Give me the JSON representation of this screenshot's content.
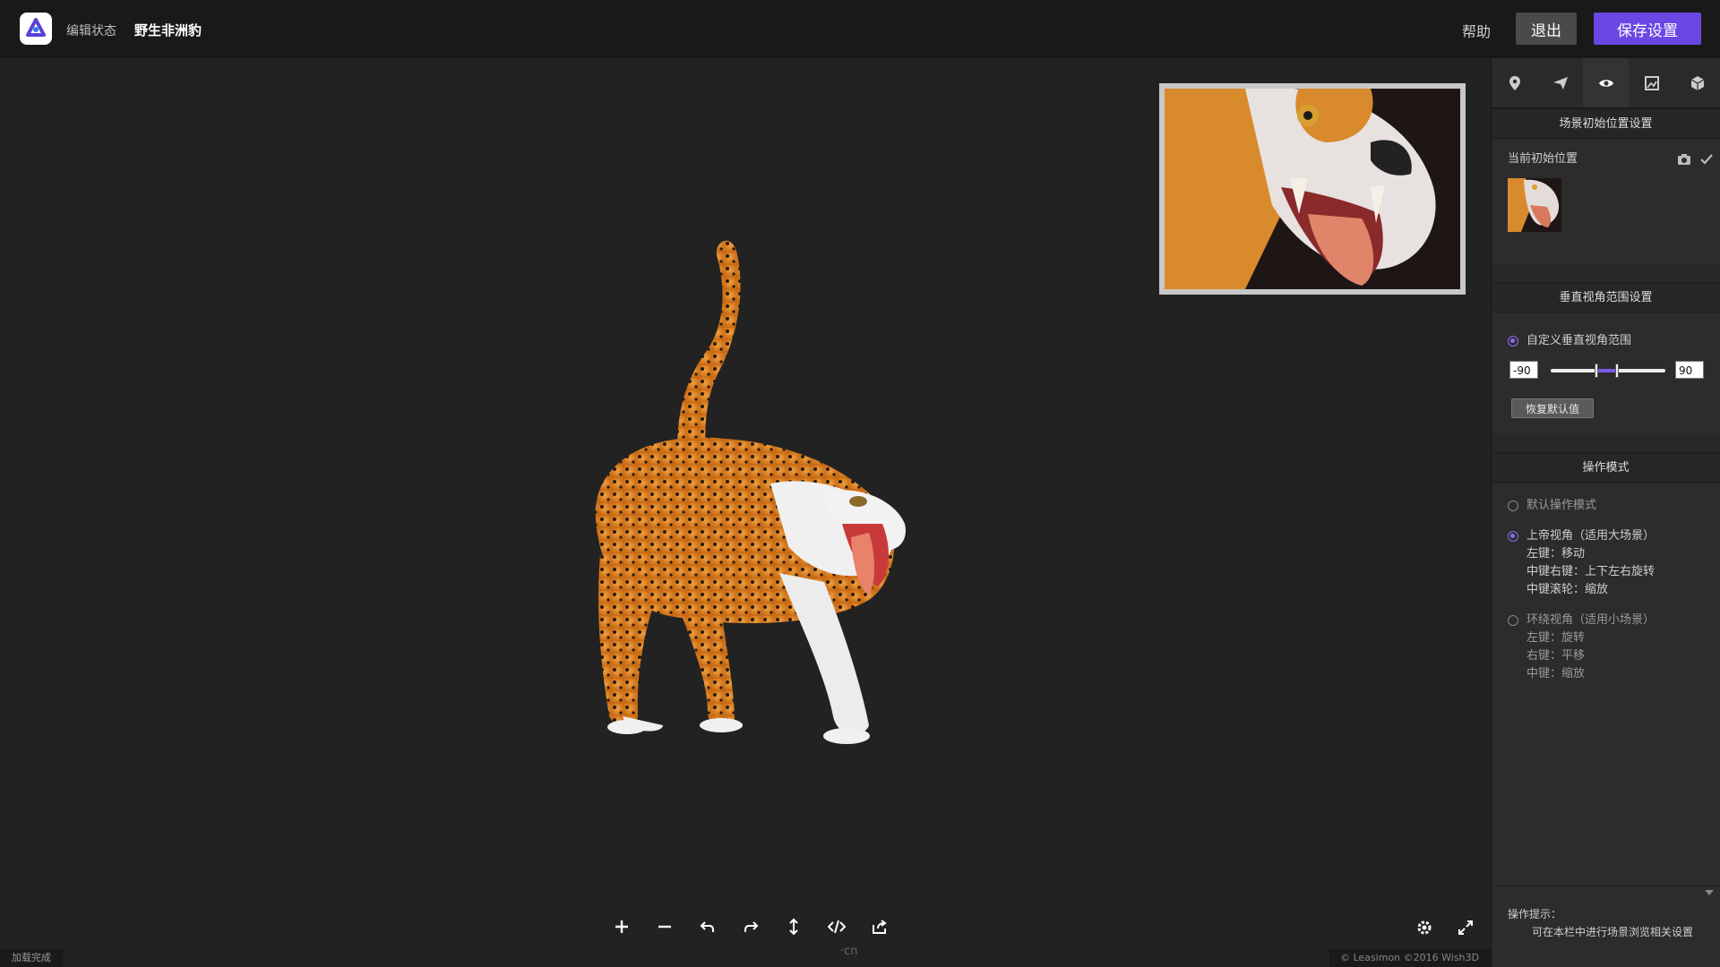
{
  "header": {
    "status_label": "编辑状态",
    "model_title": "野生非洲豹",
    "help_label": "帮助",
    "exit_label": "退出",
    "save_label": "保存设置"
  },
  "colors": {
    "accent": "#6a47e3",
    "background": "#202020",
    "panel": "#2c2c2c"
  },
  "panel_tabs": [
    {
      "icon": "location-pin-icon",
      "active": false
    },
    {
      "icon": "paper-plane-icon",
      "active": false
    },
    {
      "icon": "eye-icon",
      "active": true
    },
    {
      "icon": "image-icon",
      "active": false
    },
    {
      "icon": "cube-icon",
      "active": false
    }
  ],
  "scene_start": {
    "heading": "场景初始位置设置",
    "current_label": "当前初始位置"
  },
  "vertical_angle": {
    "heading": "垂直视角范围设置",
    "custom_label": "自定义垂直视角范围",
    "min_value": "-90",
    "max_value": "90",
    "range_low_fraction": 0.4,
    "range_high_fraction": 0.58,
    "reset_label": "恢复默认值"
  },
  "operation_mode": {
    "heading": "操作模式",
    "modes": [
      {
        "label": "默认操作模式",
        "selected": false,
        "details": []
      },
      {
        "label": "上帝视角（适用大场景）",
        "selected": true,
        "details": [
          "左键：移动",
          "中键右键：上下左右旋转",
          "中键滚轮：缩放"
        ]
      },
      {
        "label": "环绕视角（适用小场景）",
        "selected": false,
        "details": [
          "左键：旋转",
          "右键：平移",
          "中键：缩放"
        ]
      }
    ]
  },
  "hint": {
    "title": "操作提示：",
    "text": "可在本栏中进行场景浏览相关设置"
  },
  "status_bar": {
    "left": "加载完成",
    "copyright": "© Leasimon    ©2016 Wish3D"
  },
  "watermark": "·cn",
  "toolbar_icons": [
    "plus-icon",
    "minus-icon",
    "undo-icon",
    "redo-icon",
    "vertical-arrows-icon",
    "code-icon",
    "share-icon"
  ]
}
